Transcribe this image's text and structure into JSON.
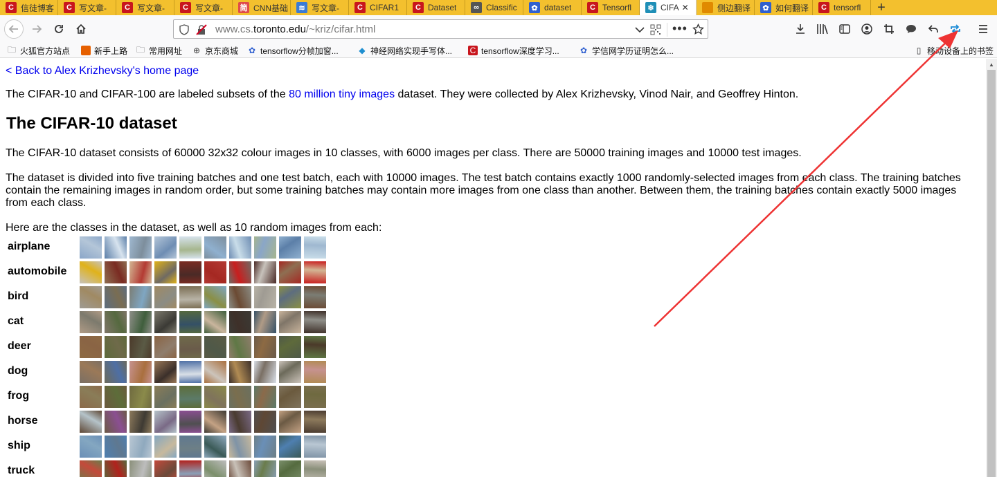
{
  "tabs": [
    {
      "label": "信徒博客",
      "icon_color": "#c8161d",
      "icon_text": "C"
    },
    {
      "label": "写文章-",
      "icon_color": "#c8161d",
      "icon_text": "C"
    },
    {
      "label": "写文章-",
      "icon_color": "#c8161d",
      "icon_text": "C"
    },
    {
      "label": "写文章-",
      "icon_color": "#c8161d",
      "icon_text": "C"
    },
    {
      "label": "CNN基础",
      "icon_color": "#e04b4b",
      "icon_text": "简"
    },
    {
      "label": "写文章-",
      "icon_color": "#3a7bd5",
      "icon_text": "≋"
    },
    {
      "label": "CIFAR1",
      "icon_color": "#c8161d",
      "icon_text": "C"
    },
    {
      "label": "Dataset",
      "icon_color": "#c8161d",
      "icon_text": "C"
    },
    {
      "label": "Classific",
      "icon_color": "#555555",
      "icon_text": "∞"
    },
    {
      "label": "dataset",
      "icon_color": "#3060d0",
      "icon_text": "✿"
    },
    {
      "label": "Tensorfl",
      "icon_color": "#c8161d",
      "icon_text": "C"
    },
    {
      "label": "CIFA",
      "icon_color": "#1f8fb7",
      "icon_text": "❄",
      "active": true
    },
    {
      "label": "侧边翻译",
      "icon_color": "#e08a00",
      "icon_text": ""
    },
    {
      "label": "如何翻译",
      "icon_color": "#3060d0",
      "icon_text": "✿"
    },
    {
      "label": "tensorfl",
      "icon_color": "#c8161d",
      "icon_text": "C"
    }
  ],
  "tab_close": "✕",
  "tab_new": "+",
  "nav": {
    "url_prefix": "www.cs.",
    "url_host": "toronto.edu",
    "url_path": "/~kriz/cifar.html"
  },
  "bookmarks": [
    {
      "label": "火狐官方站点",
      "icon": "folder-icon"
    },
    {
      "label": "新手上路",
      "icon": "firefox-icon"
    },
    {
      "label": "常用网址",
      "icon": "folder-icon"
    },
    {
      "label": "京东商城",
      "icon": "globe-icon"
    },
    {
      "label": "tensorflow分帧加窗...",
      "icon": "baidu-icon"
    },
    {
      "label": "神经网络实现手写体...",
      "icon": "diamond-icon"
    },
    {
      "label": "tensorflow深度学习...",
      "icon": "csdn-icon"
    },
    {
      "label": "学信网学历证明怎么...",
      "icon": "baidu-icon"
    }
  ],
  "mobile_bookmarks": "移动设备上的书签",
  "page": {
    "back_link": "< Back to Alex Krizhevsky's home page",
    "intro_before": "The CIFAR-10 and CIFAR-100 are labeled subsets of the ",
    "intro_link": "80 million tiny images",
    "intro_after": " dataset. They were collected by Alex Krizhevsky, Vinod Nair, and Geoffrey Hinton.",
    "heading": "The CIFAR-10 dataset",
    "para1": "The CIFAR-10 dataset consists of 60000 32x32 colour images in 10 classes, with 6000 images per class. There are 50000 training images and 10000 test images.",
    "para2": "The dataset is divided into five training batches and one test batch, each with 10000 images. The test batch contains exactly 1000 randomly-selected images from each class. The training batches contain the remaining images in random order, but some training batches may contain more images from one class than another. Between them, the training batches contain exactly 5000 images from each class.",
    "para3": "Here are the classes in the dataset, as well as 10 random images from each:",
    "classes": [
      "airplane",
      "automobile",
      "bird",
      "cat",
      "deer",
      "dog",
      "frog",
      "horse",
      "ship",
      "truck"
    ]
  },
  "colors": {
    "tabbar": "#f3c02e",
    "link": "#0000ee",
    "annotation_arrow": "#ee3333"
  }
}
